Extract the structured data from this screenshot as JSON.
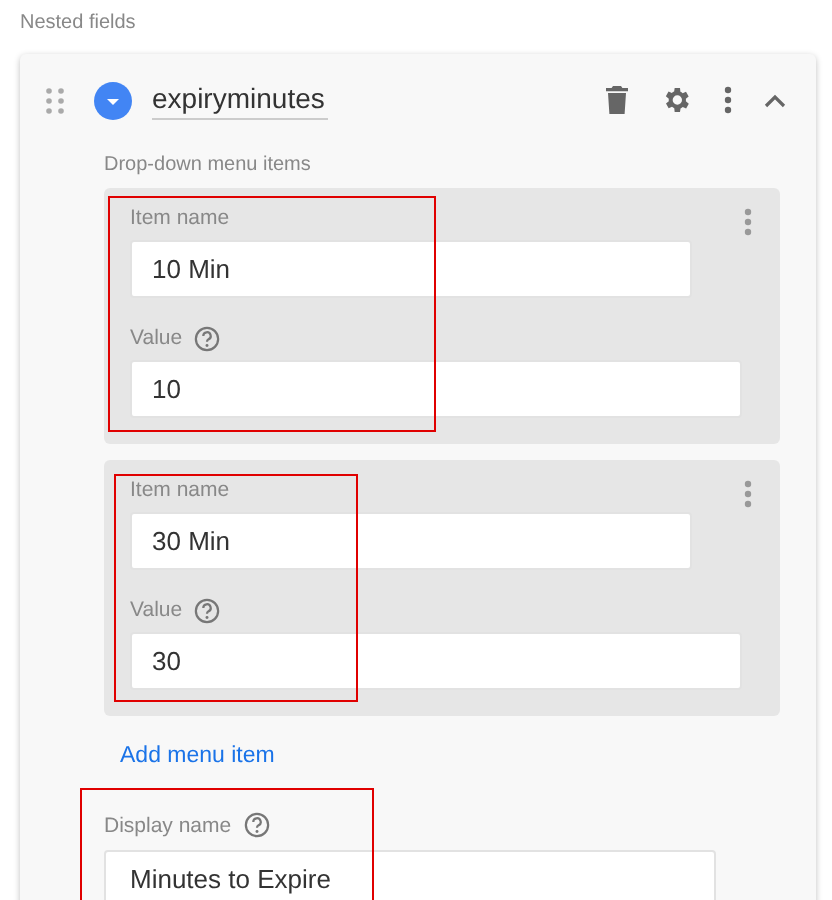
{
  "section_title": "Nested fields",
  "field": {
    "name": "expiryminutes",
    "expanded": true
  },
  "menu_items_title": "Drop-down menu items",
  "menu_items": [
    {
      "name_label": "Item name",
      "name": "10 Min",
      "value_label": "Value",
      "value": "10",
      "highlighted": true
    },
    {
      "name_label": "Item name",
      "name": "30 Min",
      "value_label": "Value",
      "value": "30",
      "highlighted": true
    }
  ],
  "add_item": "Add menu item",
  "display_name": {
    "label": "Display name",
    "value": "Minutes to Expire",
    "highlighted": true
  }
}
